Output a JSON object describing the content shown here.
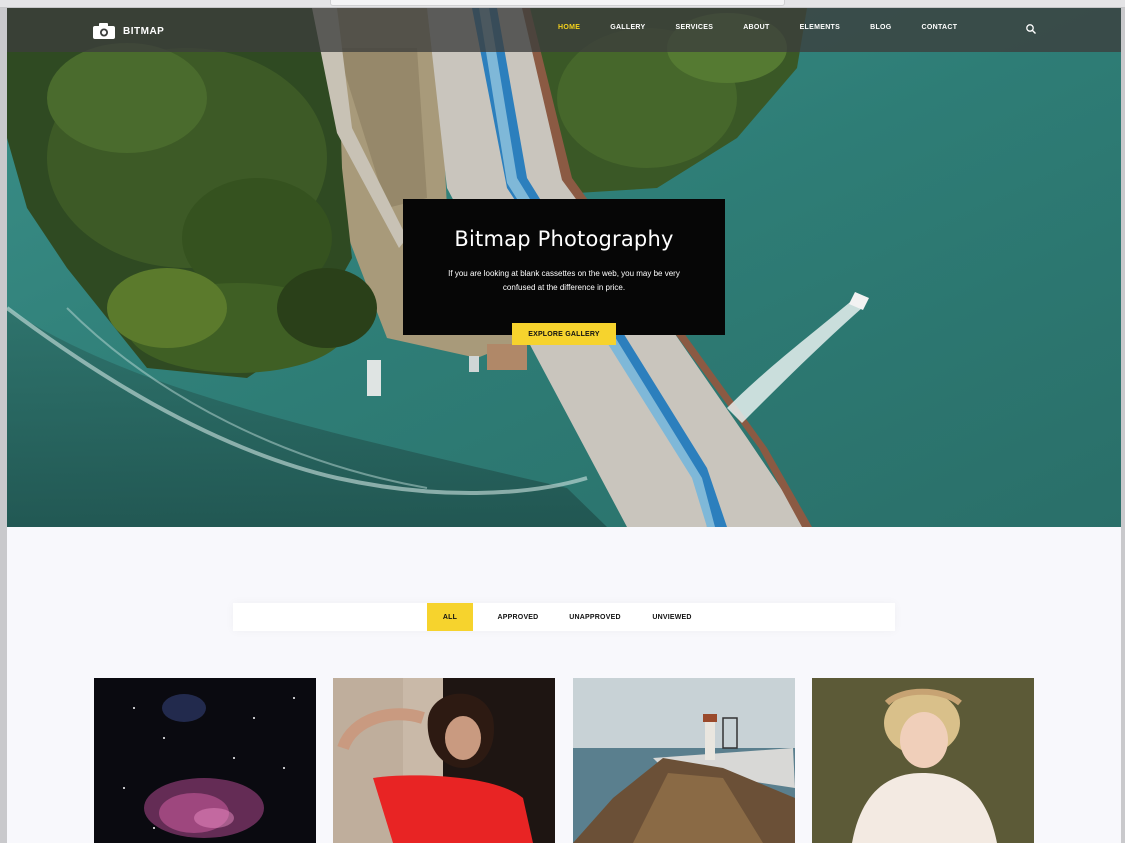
{
  "brand": {
    "name": "BITMAP"
  },
  "nav": {
    "items": [
      {
        "label": "HOME",
        "active": true
      },
      {
        "label": "GALLERY",
        "active": false
      },
      {
        "label": "SERVICES",
        "active": false
      },
      {
        "label": "ABOUT",
        "active": false
      },
      {
        "label": "ELEMENTS",
        "active": false
      },
      {
        "label": "BLOG",
        "active": false
      },
      {
        "label": "CONTACT",
        "active": false
      }
    ]
  },
  "hero": {
    "title": "Bitmap Photography",
    "description": "If you are looking at blank cassettes on the web, you may be very confused at the difference in price.",
    "cta_label": "EXPLORE GALLERY"
  },
  "filters": {
    "items": [
      "ALL",
      "APPROVED",
      "UNAPPROVED",
      "UNVIEWED"
    ],
    "active": "ALL"
  },
  "theme": {
    "accent": "#f6d32d",
    "navbar_bg": "#3c3e3c",
    "page_bg": "#f8f8fc"
  },
  "icons": {
    "logo": "camera-icon",
    "search": "search-icon"
  }
}
